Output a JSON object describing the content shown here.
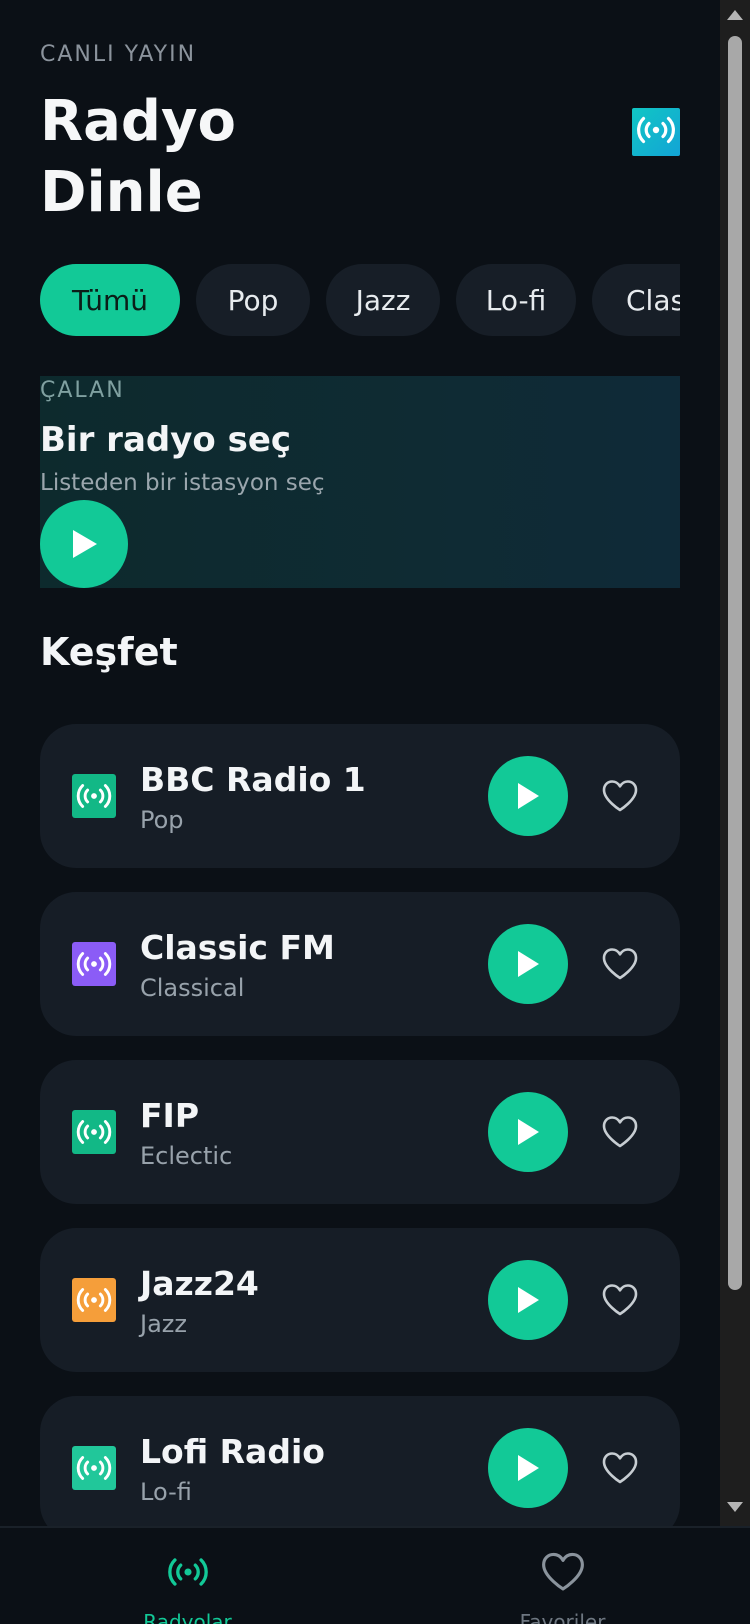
{
  "header": {
    "eyebrow": "CANLI YAYIN",
    "title_line1": "Radyo",
    "title_line2": "Dinle",
    "logo_icon": "radio-broadcast-icon"
  },
  "filters": [
    {
      "label": "Tümü",
      "active": true
    },
    {
      "label": "Pop",
      "active": false
    },
    {
      "label": "Jazz",
      "active": false
    },
    {
      "label": "Lo-fi",
      "active": false
    },
    {
      "label": "Classical",
      "active": false
    }
  ],
  "now_playing": {
    "label": "ÇALAN",
    "title": "Bir radyo seç",
    "subtitle": "Listeden bir istasyon seç"
  },
  "section": {
    "title": "Keşfet"
  },
  "stations": [
    {
      "name": "BBC Radio 1",
      "genre": "Pop",
      "icon_color": "#12b886"
    },
    {
      "name": "Classic FM",
      "genre": "Classical",
      "icon_color": "#8b5cf6"
    },
    {
      "name": "FIP",
      "genre": "Eclectic",
      "icon_color": "#12b886"
    },
    {
      "name": "Jazz24",
      "genre": "Jazz",
      "icon_color": "#f59e3a"
    },
    {
      "name": "Lofi Radio",
      "genre": "Lo-fi",
      "icon_color": "#21c79a"
    }
  ],
  "bottom_nav": [
    {
      "label": "Radyolar",
      "icon": "radio-broadcast-icon",
      "active": true
    },
    {
      "label": "Favoriler",
      "icon": "heart-icon",
      "active": false
    }
  ],
  "colors": {
    "accent": "#12c997",
    "background": "#0b1016",
    "card": "#161d26"
  }
}
